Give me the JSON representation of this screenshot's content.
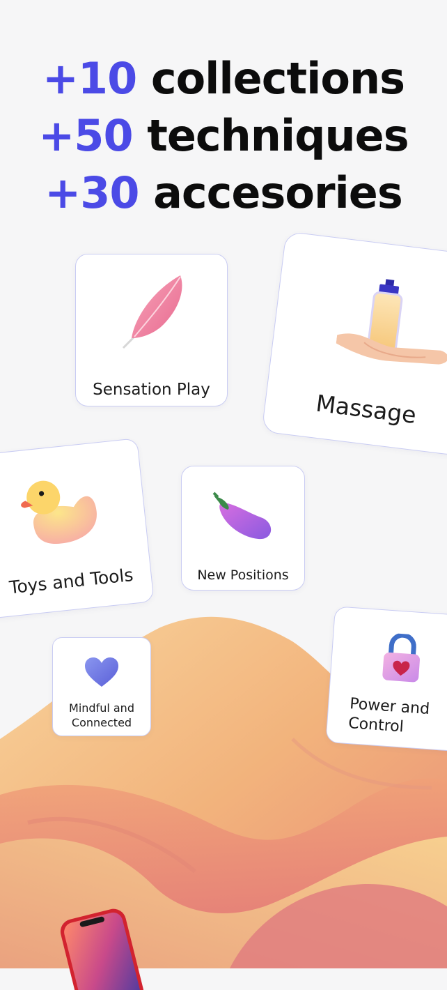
{
  "headline": {
    "line1_num": "+10",
    "line1_word": "collections",
    "line2_num": "+50",
    "line2_word": "techniques",
    "line3_num": "+30",
    "line3_word": "accesories"
  },
  "cards": {
    "sensation": {
      "label": "Sensation Play",
      "icon": "feather-icon"
    },
    "massage": {
      "label": "Massage",
      "icon": "massage-oil-hand-icon"
    },
    "toys": {
      "label": "Toys and Tools",
      "icon": "rubber-duck-icon"
    },
    "new_positions": {
      "label": "New Positions",
      "icon": "eggplant-icon"
    },
    "mindful": {
      "label": "Mindful and Connected",
      "icon": "heart-icon"
    },
    "power": {
      "label": "Power and Control",
      "icon": "heart-lock-icon"
    }
  },
  "colors": {
    "accent": "#4b4ae6",
    "text": "#0c0c0c",
    "background": "#f6f6f7",
    "card_border": "#c9ccf3",
    "blanket_light": "#f6c98a",
    "blanket_dark": "#e27f7f"
  }
}
